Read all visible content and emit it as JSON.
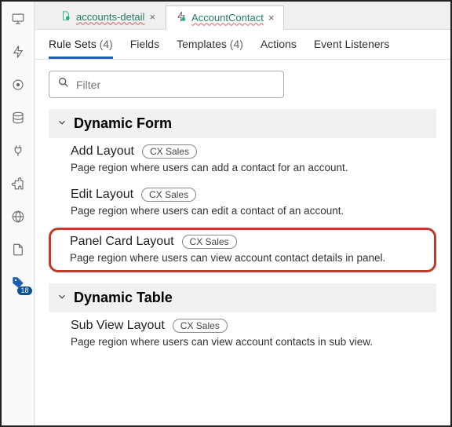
{
  "tabs": [
    {
      "label": "accounts-detail",
      "active": false
    },
    {
      "label": "AccountContact",
      "active": true
    }
  ],
  "subtabs": {
    "rulesets": {
      "label": "Rule Sets",
      "count": "(4)"
    },
    "fields": {
      "label": "Fields"
    },
    "templates": {
      "label": "Templates",
      "count": "(4)"
    },
    "actions": {
      "label": "Actions"
    },
    "eventlisteners": {
      "label": "Event Listeners"
    }
  },
  "filter_placeholder": "Filter",
  "sections": {
    "dynamic_form": {
      "title": "Dynamic Form",
      "items": [
        {
          "title": "Add Layout",
          "pill": "CX Sales",
          "desc": "Page region where users can add a contact for an account."
        },
        {
          "title": "Edit Layout",
          "pill": "CX Sales",
          "desc": "Page region where users can edit a contact of an account."
        },
        {
          "title": "Panel Card Layout",
          "pill": "CX Sales",
          "desc": "Page region where users can view account contact details in panel."
        }
      ]
    },
    "dynamic_table": {
      "title": "Dynamic Table",
      "items": [
        {
          "title": "Sub View Layout",
          "pill": "CX Sales",
          "desc": "Page region where users can view account contacts in sub view."
        }
      ]
    }
  },
  "sidebar_badge": "18"
}
